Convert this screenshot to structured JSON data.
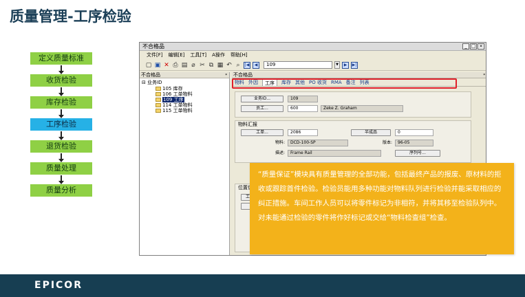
{
  "slide": {
    "title": "质量管理-工序检验",
    "footer_logo": "EPICOR"
  },
  "flow": {
    "steps": [
      "定义质量标准",
      "收货检验",
      "库存检验",
      "工序检验",
      "退货检验",
      "质量处理",
      "质量分析"
    ],
    "active_index": 3
  },
  "window": {
    "title": "不合格品",
    "menu": [
      "文件[F]",
      "编辑[E]",
      "工具[T]",
      "A操作",
      "帮助[H]"
    ],
    "nav_value": "109",
    "left_pane_header": "不合格品",
    "right_pane_header": "不合格品",
    "tree": {
      "root": "业务ID",
      "items": [
        "105 库存",
        "106 工单物料",
        "109 工序",
        "114 工单物料",
        "115 工单物料"
      ],
      "selected_index": 2
    },
    "tabs": [
      "物料",
      "外因",
      "工序",
      "库存",
      "其他",
      "PO 收货",
      "RMA",
      "备注",
      "列表"
    ],
    "active_tab_index": 2,
    "detail": {
      "business_id_button": "业务ID...",
      "business_id_value": "109",
      "employee_button": "员工...",
      "employee_id": "600",
      "employee_name": "Zeke Z. Graham",
      "group_material_title": "物料汇报",
      "job_button": "工单...",
      "job_value": "2086",
      "assembly_button": "半成品",
      "assembly_value": "0",
      "part_label": "物料:",
      "part_value": "DCD-100-SP",
      "revision_label": "版本:",
      "revision_value": "96-05",
      "desc_label": "描述:",
      "desc_value": "Frame Rail",
      "serial_button": "序列号...",
      "group_location_title": "位置信",
      "location_button": "工"
    }
  },
  "callout": {
    "text": "“质量保证”模块具有质量管理的全部功能，包括最终产品的报废、原材料的拒收或跟踪首件检验。检验员能用多种功能对物料队列进行检验并能采取相应的纠正措施。车间工作人员可以将零件标记为非相符，并将其移至检验队列中。对未能通过检验的零件将作好标记或交给“物料检查组”检查。"
  },
  "colors": {
    "step_green": "#8fd045",
    "step_active_blue": "#26b1e6",
    "callout_orange": "#f3b21a",
    "footer_navy": "#173e52",
    "highlight_red": "#e0202a"
  }
}
